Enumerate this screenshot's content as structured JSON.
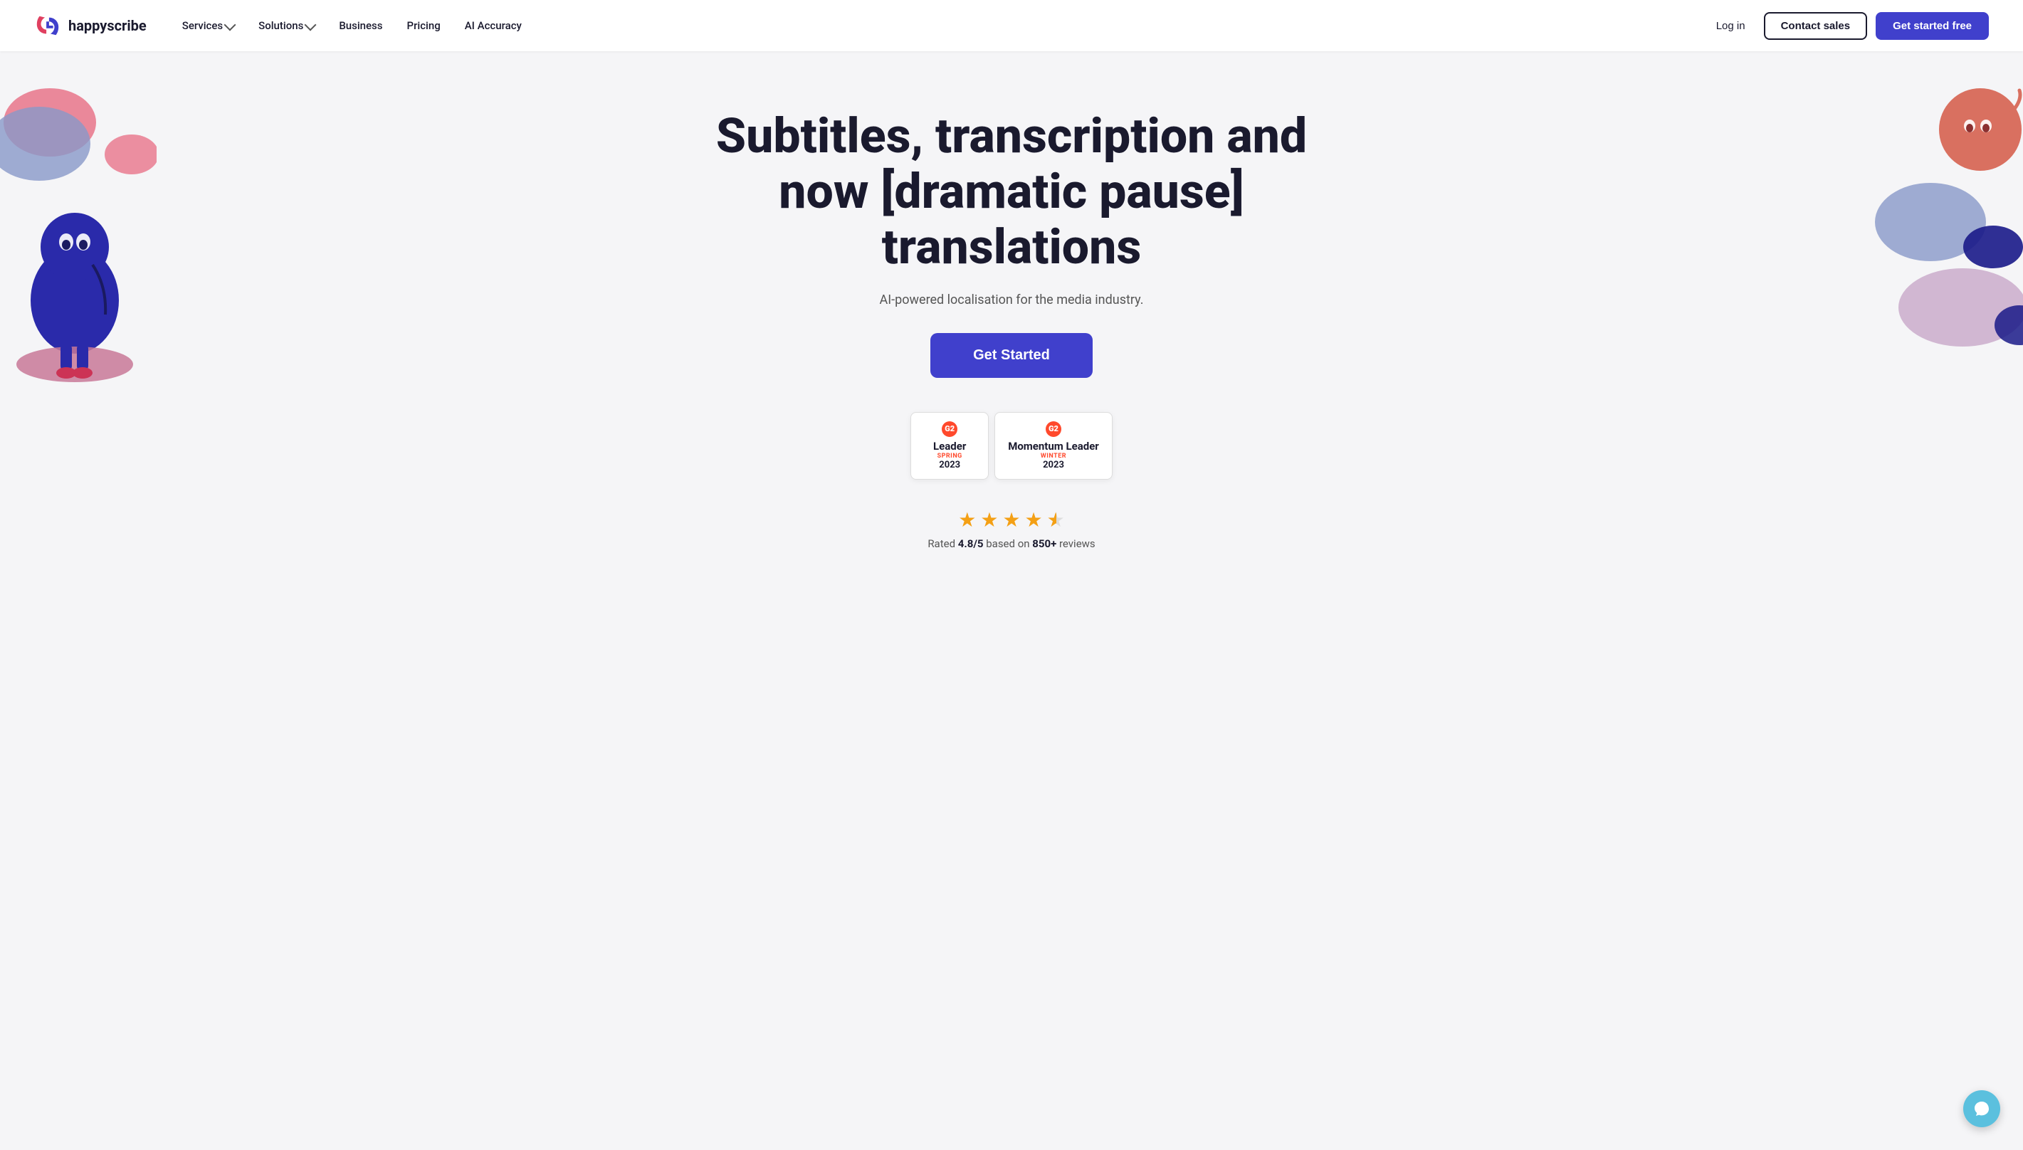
{
  "brand": {
    "name": "happyscribe",
    "logo_alt": "Happy Scribe logo"
  },
  "nav": {
    "links": [
      {
        "label": "Services",
        "has_dropdown": true
      },
      {
        "label": "Solutions",
        "has_dropdown": true
      },
      {
        "label": "Business",
        "has_dropdown": false
      },
      {
        "label": "Pricing",
        "has_dropdown": false
      },
      {
        "label": "AI Accuracy",
        "has_dropdown": false
      }
    ],
    "login_label": "Log in",
    "contact_label": "Contact sales",
    "cta_label": "Get started free"
  },
  "hero": {
    "title": "Subtitles, transcription and now [dramatic pause] translations",
    "subtitle": "AI-powered localisation for the media industry.",
    "cta_label": "Get Started"
  },
  "badges": [
    {
      "g2_label": "G2",
      "title": "Leader",
      "season": "SPRING",
      "year": "2023"
    },
    {
      "g2_label": "G2",
      "title": "Momentum Leader",
      "season": "WINTER",
      "year": "2023"
    }
  ],
  "rating": {
    "score": "4.8/5",
    "reviews": "850+",
    "text_before": "Rated ",
    "text_after": " based on ",
    "text_end": " reviews"
  },
  "chat": {
    "label": "Chat support"
  }
}
